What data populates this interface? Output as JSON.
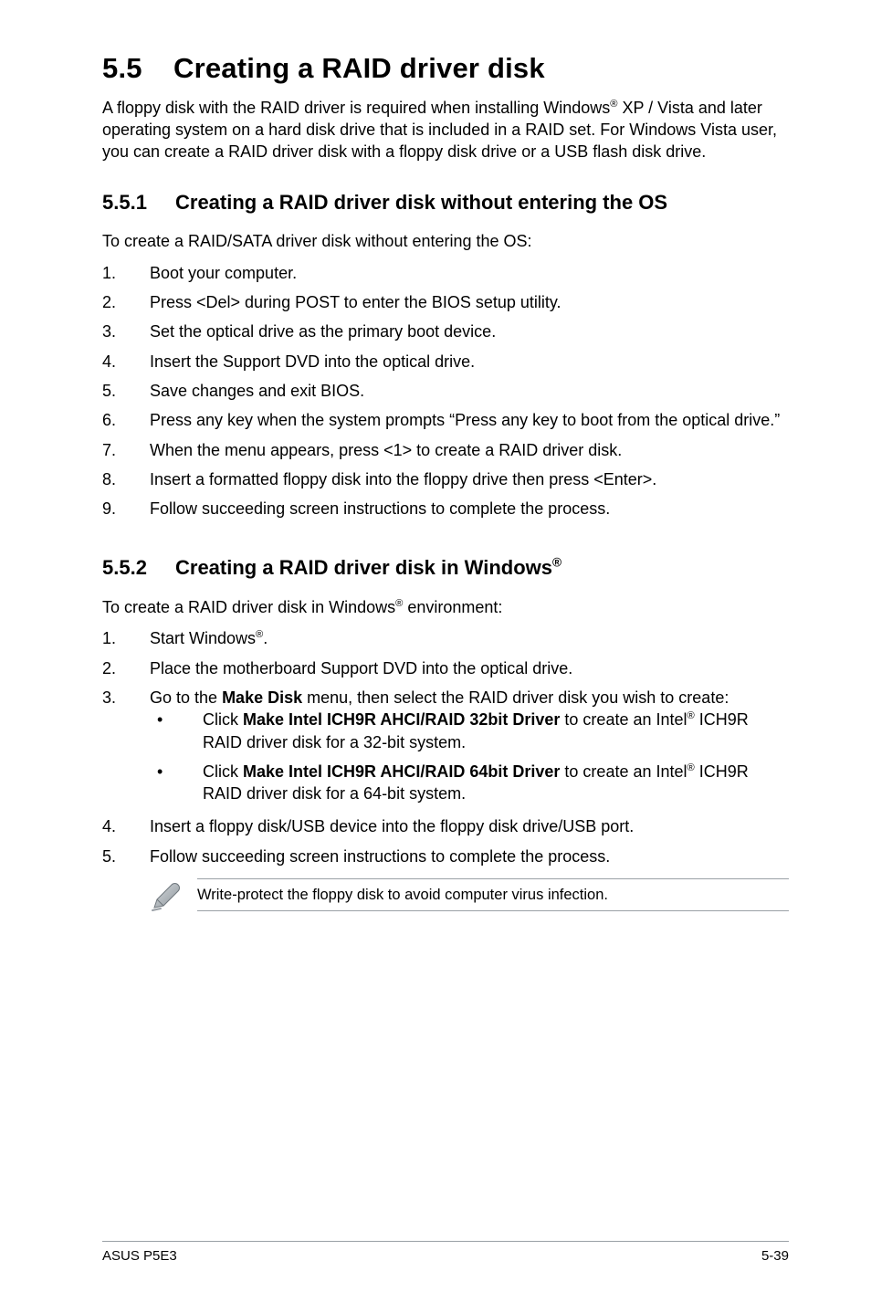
{
  "title": {
    "num": "5.5",
    "text": "Creating a RAID driver disk"
  },
  "intro": "A floppy disk with the RAID driver is required when installing Windows® XP / Vista and later operating system on a hard disk drive that is included in a RAID set. For Windows Vista user, you can create a RAID driver disk with a floppy disk drive or a USB flash disk drive.",
  "s1": {
    "num": "5.5.1",
    "head": "Creating a RAID driver disk without entering the OS",
    "lead": "To create a RAID/SATA driver disk without entering the OS:",
    "steps": [
      "Boot your computer.",
      "Press <Del> during POST to enter the BIOS setup utility.",
      "Set the optical drive as the primary boot device.",
      "Insert the Support DVD into the optical drive.",
      "Save changes and exit BIOS.",
      "Press any key when the system prompts “Press any key to boot from the optical drive.”",
      "When the menu appears, press <1> to create a RAID driver disk.",
      "Insert a formatted floppy disk into the floppy drive then press <Enter>.",
      "Follow succeeding screen instructions to complete the process."
    ]
  },
  "s2": {
    "num": "5.5.2",
    "head": "Creating a RAID driver disk in Windows®",
    "lead": "To create a RAID driver disk in Windows® environment:",
    "steps12": [
      "Start Windows®.",
      "Place the motherboard Support DVD into the optical drive."
    ],
    "step3_pre": "Go to the ",
    "step3_bold": "Make Disk",
    "step3_post": " menu, then select the RAID driver disk you wish to create:",
    "bullet1_pre": "Click ",
    "bullet1_bold": "Make Intel ICH9R AHCI/RAID 32bit Driver",
    "bullet1_post": " to create an Intel® ICH9R RAID driver disk for a 32-bit system.",
    "bullet2_pre": "Click ",
    "bullet2_bold": "Make Intel ICH9R AHCI/RAID 64bit Driver",
    "bullet2_post": " to create an Intel® ICH9R RAID driver disk for a 64-bit system.",
    "steps45": [
      "Insert a floppy disk/USB device into the floppy disk drive/USB port.",
      "Follow succeeding screen instructions to complete the process."
    ]
  },
  "note": "Write-protect the floppy disk to avoid computer virus infection.",
  "footer": {
    "left": "ASUS P5E3",
    "right": "5-39"
  }
}
